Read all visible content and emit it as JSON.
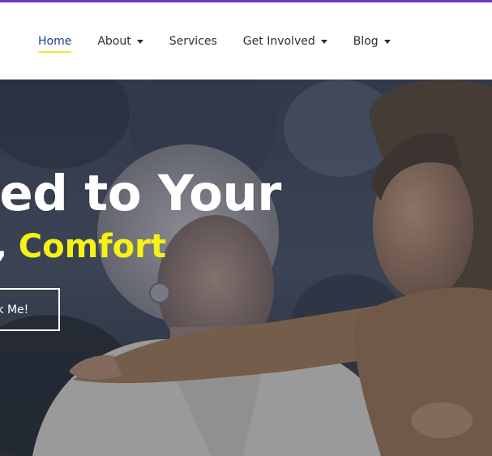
{
  "nav": {
    "items": [
      {
        "label": "Home",
        "active": true,
        "has_dropdown": false
      },
      {
        "label": "About",
        "active": false,
        "has_dropdown": true
      },
      {
        "label": "Services",
        "active": false,
        "has_dropdown": false
      },
      {
        "label": "Get Involved",
        "active": false,
        "has_dropdown": true
      },
      {
        "label": "Blog",
        "active": false,
        "has_dropdown": true
      }
    ]
  },
  "hero": {
    "title": "ated to Your",
    "subtitle_prefix": "g, ",
    "subtitle_highlight": "Comfort",
    "cta_label": "ck Me!",
    "highlight_color": "#f6f314"
  },
  "colors": {
    "top_accent": "#6a3cc4",
    "nav_active": "#1d3d8f",
    "nav_underline": "#f4e63a"
  }
}
